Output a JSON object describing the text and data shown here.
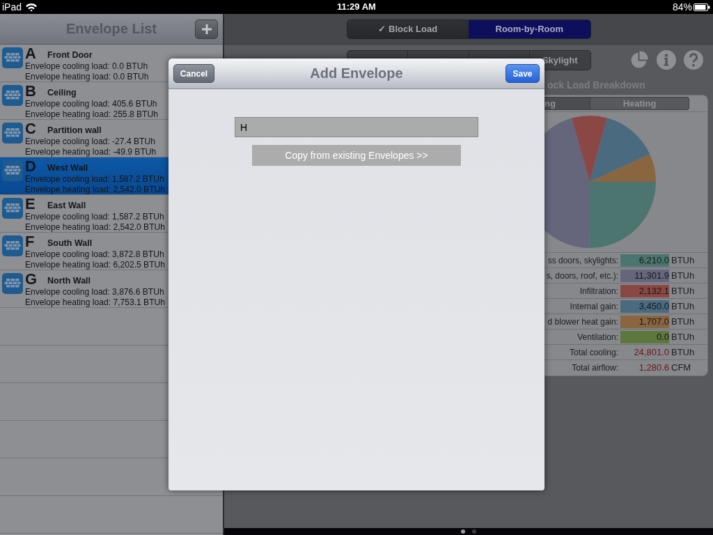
{
  "status_bar": {
    "device": "iPad",
    "time": "11:29 AM",
    "battery": "84%"
  },
  "envelope_list": {
    "title": "Envelope List",
    "items": [
      {
        "letter": "A",
        "name": "Front Door",
        "cooling": "Envelope cooling load: 0.0 BTUh",
        "heating": "Envelope heating load: 0.0 BTUh",
        "selected": false
      },
      {
        "letter": "B",
        "name": "Ceiling",
        "cooling": "Envelope cooling load: 405.6 BTUh",
        "heating": "Envelope heating load: 255.8 BTUh",
        "selected": false
      },
      {
        "letter": "C",
        "name": "Partition wall",
        "cooling": "Envelope cooling load: -27.4 BTUh",
        "heating": "Envelope heating load: -49.9 BTUh",
        "selected": false
      },
      {
        "letter": "D",
        "name": "West Wall",
        "cooling": "Envelope cooling load: 1,587.2 BTUh",
        "heating": "Envelope heating load: 2,542.0 BTUh",
        "selected": true
      },
      {
        "letter": "E",
        "name": "East Wall",
        "cooling": "Envelope cooling load: 1,587.2 BTUh",
        "heating": "Envelope heating load: 2,542.0 BTUh",
        "selected": false
      },
      {
        "letter": "F",
        "name": "South Wall",
        "cooling": "Envelope cooling load: 3,872.8 BTUh",
        "heating": "Envelope heating load: 6,202.5 BTUh",
        "selected": false
      },
      {
        "letter": "G",
        "name": "North Wall",
        "cooling": "Envelope cooling load: 3,876.6 BTUh",
        "heating": "Envelope heating load: 7,753.1 BTUh",
        "selected": false
      }
    ]
  },
  "mode_tabs": [
    {
      "label": "✓ Block Load",
      "selected": false
    },
    {
      "label": "Room-by-Room",
      "selected": true
    }
  ],
  "section_tabs": [
    {
      "label": "Skylight",
      "selected": false
    }
  ],
  "breakdown": {
    "title": "ock Load Breakdown",
    "tabs": [
      {
        "label": "ng",
        "selected": true
      },
      {
        "label": "Heating",
        "selected": false
      }
    ],
    "chart_data": {
      "type": "pie",
      "values": [
        25.04,
        45.57,
        8.6,
        13.91,
        6.88,
        0.0
      ]
    },
    "rows": [
      {
        "kind": "swatch",
        "label": "ss doors, skylights:",
        "value": "6,210.0",
        "unit": "BTUh",
        "color": "#4d7570"
      },
      {
        "kind": "swatch",
        "label": "s, doors, roof, etc.):",
        "value": "11,301.9",
        "unit": "BTUh",
        "color": "#65667b"
      },
      {
        "kind": "swatch",
        "label": "Infiltration:",
        "value": "2,132.1",
        "unit": "BTUh",
        "color": "#8a4744"
      },
      {
        "kind": "swatch",
        "label": "Internal gain:",
        "value": "3,450.0",
        "unit": "BTUh",
        "color": "#4a6a80"
      },
      {
        "kind": "swatch",
        "label": "d blower heat gain:",
        "value": "1,707.0",
        "unit": "BTUh",
        "color": "#8a6640"
      },
      {
        "kind": "swatch",
        "label": "Ventilation:",
        "value": "0.0",
        "unit": "BTUh",
        "color": "#5e773d"
      },
      {
        "kind": "total",
        "label": "Total cooling:",
        "value": "24,801.0",
        "unit": "BTUh"
      },
      {
        "kind": "total",
        "label": "Total airflow:",
        "value": "1,280.6",
        "unit": "CFM"
      }
    ]
  },
  "page_dots": [
    {
      "selected": true
    },
    {
      "selected": false
    }
  ],
  "dialog": {
    "title": "Add Envelope",
    "cancel": "Cancel",
    "save": "Save",
    "name_field": {
      "value": "H"
    },
    "copy_button": "Copy from existing Envelopes >>"
  }
}
